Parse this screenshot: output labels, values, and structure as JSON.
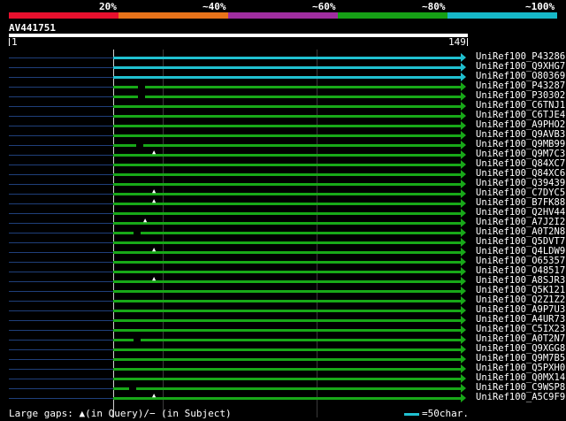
{
  "legend": {
    "labels": [
      "20%",
      "~40%",
      "~60%",
      "~80%",
      "~100%"
    ],
    "colors": [
      "#e8102e",
      "#e8731a",
      "#a02ea0",
      "#16a016",
      "#16b8c8"
    ]
  },
  "query": {
    "id": "AV441751",
    "start": "1",
    "end": "149"
  },
  "colors": {
    "green": "#18a818",
    "cyan": "#20c0d0",
    "lead": "#1f3f7a"
  },
  "hits": [
    {
      "label": "UniRef100_P43286",
      "color": "cyan",
      "gq": null,
      "gs": null
    },
    {
      "label": "UniRef100_Q9XHG7",
      "color": "cyan",
      "gq": null,
      "gs": null
    },
    {
      "label": "UniRef100_O80369",
      "color": "cyan",
      "gq": null,
      "gs": null
    },
    {
      "label": "UniRef100_P43287",
      "color": "green",
      "gq": null,
      "gs": "160"
    },
    {
      "label": "UniRef100_P30302",
      "color": "green",
      "gq": null,
      "gs": "160"
    },
    {
      "label": "UniRef100_C6TNJ1",
      "color": "green",
      "gq": null,
      "gs": null
    },
    {
      "label": "UniRef100_C6TJE4",
      "color": "green",
      "gq": null,
      "gs": null
    },
    {
      "label": "UniRef100_A9PHO2",
      "color": "green",
      "gq": null,
      "gs": null
    },
    {
      "label": "UniRef100_Q9AVB3",
      "color": "green",
      "gq": null,
      "gs": null
    },
    {
      "label": "UniRef100_Q9MB99",
      "color": "green",
      "gq": null,
      "gs": "158"
    },
    {
      "label": "UniRef100_Q9M7C3",
      "color": "green",
      "gq": "175",
      "gs": null
    },
    {
      "label": "UniRef100_Q84XC7",
      "color": "green",
      "gq": null,
      "gs": null
    },
    {
      "label": "UniRef100_Q84XC6",
      "color": "green",
      "gq": null,
      "gs": null
    },
    {
      "label": "UniRef100_Q39439",
      "color": "green",
      "gq": null,
      "gs": null
    },
    {
      "label": "UniRef100_C7DYC5",
      "color": "green",
      "gq": "175",
      "gs": null
    },
    {
      "label": "UniRef100_B7FK88",
      "color": "green",
      "gq": "175",
      "gs": null
    },
    {
      "label": "UniRef100_Q2HV44",
      "color": "green",
      "gq": null,
      "gs": null
    },
    {
      "label": "UniRef100_A7J2I2",
      "color": "green",
      "gq": "165",
      "gs": null
    },
    {
      "label": "UniRef100_A0T2N8",
      "color": "green",
      "gq": null,
      "gs": "155"
    },
    {
      "label": "UniRef100_Q5DVT7",
      "color": "green",
      "gq": null,
      "gs": null
    },
    {
      "label": "UniRef100_Q4LDW9",
      "color": "green",
      "gq": "175",
      "gs": null
    },
    {
      "label": "UniRef100_O65357",
      "color": "green",
      "gq": null,
      "gs": null
    },
    {
      "label": "UniRef100_O48517",
      "color": "green",
      "gq": null,
      "gs": null
    },
    {
      "label": "UniRef100_A8SJR3",
      "color": "green",
      "gq": "175",
      "gs": null
    },
    {
      "label": "UniRef100_Q5K121",
      "color": "green",
      "gq": null,
      "gs": null
    },
    {
      "label": "UniRef100_Q2Z1Z2",
      "color": "green",
      "gq": null,
      "gs": null
    },
    {
      "label": "UniRef100_A9P7U3",
      "color": "green",
      "gq": null,
      "gs": null
    },
    {
      "label": "UniRef100_A4UR73",
      "color": "green",
      "gq": null,
      "gs": null
    },
    {
      "label": "UniRef100_C5IX23",
      "color": "green",
      "gq": null,
      "gs": null
    },
    {
      "label": "UniRef100_A0T2N7",
      "color": "green",
      "gq": null,
      "gs": "155"
    },
    {
      "label": "UniRef100_Q9XGG8",
      "color": "green",
      "gq": null,
      "gs": null
    },
    {
      "label": "UniRef100_Q9M7B5",
      "color": "green",
      "gq": null,
      "gs": null
    },
    {
      "label": "UniRef100_Q5PXH0",
      "color": "green",
      "gq": null,
      "gs": null
    },
    {
      "label": "UniRef100_Q0MX14",
      "color": "green",
      "gq": null,
      "gs": null
    },
    {
      "label": "UniRef100_C9WSP8",
      "color": "green",
      "gq": null,
      "gs": "150"
    },
    {
      "label": "UniRef100_A5C9F9",
      "color": "green",
      "gq": "175",
      "gs": null
    }
  ],
  "footer": {
    "gaps_text": "Large gaps: ▲(in Query)/− (in Subject)",
    "scale_text": "=50char."
  }
}
